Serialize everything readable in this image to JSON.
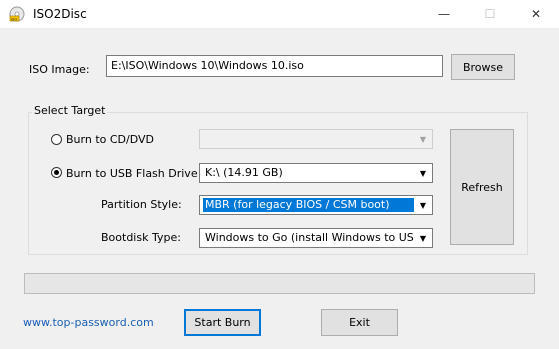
{
  "window": {
    "title": "ISO2Disc",
    "controls": {
      "minimize": "—",
      "maximize": "☐",
      "close": "✕"
    }
  },
  "iso": {
    "label": "ISO Image:",
    "value": "E:\\ISO\\Windows 10\\Windows 10.iso",
    "browse_label": "Browse"
  },
  "target": {
    "group_label": "Select Target",
    "burn_cd_label": "Burn to CD/DVD",
    "burn_cd_selected": false,
    "cd_drive_value": "",
    "burn_usb_label": "Burn to USB Flash Drive",
    "burn_usb_selected": true,
    "usb_drive_value": "K:\\ (14.91 GB)",
    "partition_label": "Partition Style:",
    "partition_value": "MBR (for legacy BIOS / CSM boot)",
    "bootdisk_label": "Bootdisk Type:",
    "bootdisk_value": "Windows to Go (install Windows to USB)",
    "refresh_label": "Refresh"
  },
  "progress": {
    "value_percent": 0
  },
  "footer": {
    "link_text": "www.top-password.com",
    "start_label": "Start Burn",
    "exit_label": "Exit"
  },
  "colors": {
    "accent": "#0078d7",
    "link": "#1a5fb4"
  }
}
